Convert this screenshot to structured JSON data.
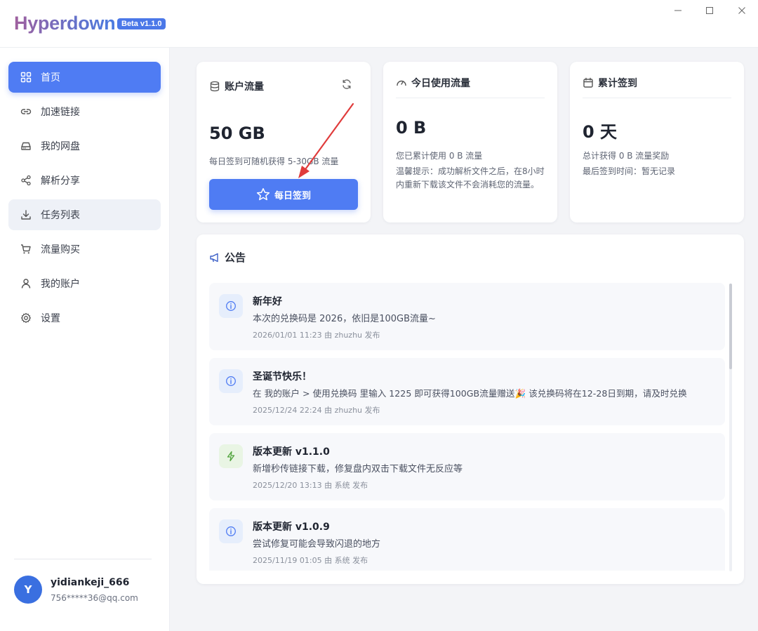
{
  "app": {
    "name": "Hyperdown",
    "version_badge": "Beta v1.1.0"
  },
  "window_controls": {
    "minimize": "—",
    "maximize": "☐",
    "close": "✕"
  },
  "sidebar": {
    "items": [
      {
        "label": "首页",
        "icon": "grid-icon",
        "active": true
      },
      {
        "label": "加速链接",
        "icon": "link-icon"
      },
      {
        "label": "我的网盘",
        "icon": "drive-icon"
      },
      {
        "label": "解析分享",
        "icon": "share-icon"
      },
      {
        "label": "任务列表",
        "icon": "download-icon",
        "hover": true
      },
      {
        "label": "流量购买",
        "icon": "cart-icon"
      },
      {
        "label": "我的账户",
        "icon": "user-icon"
      },
      {
        "label": "设置",
        "icon": "gear-icon"
      }
    ],
    "user": {
      "avatar_letter": "Y",
      "name": "yidiankeji_666",
      "email": "756*****36@qq.com"
    }
  },
  "cards": {
    "account": {
      "title": "账户流量",
      "value": "50 GB",
      "hint": "每日签到可随机获得 5-30GB 流量",
      "button": "每日签到"
    },
    "today": {
      "title": "今日使用流量",
      "value": "0 B",
      "line1": "您已累计使用 0 B 流量",
      "line2": "温馨提示：成功解析文件之后，在8小时",
      "line3": "内重新下载该文件不会消耗您的流量。"
    },
    "checkin": {
      "title": "累计签到",
      "value": "0 天",
      "line1": "总计获得 0 B 流量奖励",
      "line2": "最后签到时间：暂无记录"
    }
  },
  "announcements": {
    "title": "公告",
    "items": [
      {
        "title": "新年好",
        "body": "本次的兑换码是 2026，依旧是100GB流量~",
        "meta": "2026/01/01 11:23   由 zhuzhu 发布",
        "icon": "info-icon"
      },
      {
        "title": "圣诞节快乐！",
        "body": "在 我的账户 > 使用兑换码 里输入 1225 即可获得100GB流量赠送🎉 该兑换码将在12-28日到期，请及时兑换",
        "meta": "2025/12/24 22:24   由 zhuzhu 发布",
        "icon": "info-icon"
      },
      {
        "title": "版本更新 v1.1.0",
        "body": "新增秒传链接下载，修复盘内双击下载文件无反应等",
        "meta": "2025/12/20 13:13   由 系统 发布",
        "icon": "lightning-icon"
      },
      {
        "title": "版本更新 v1.0.9",
        "body": "尝试修复可能会导致闪退的地方",
        "meta": "2025/11/19 01:05   由 系统 发布",
        "icon": "info-icon"
      }
    ]
  },
  "colors": {
    "accent": "#4f7cf3",
    "badge": "#4b78e8",
    "arrow": "#e03b3b"
  }
}
